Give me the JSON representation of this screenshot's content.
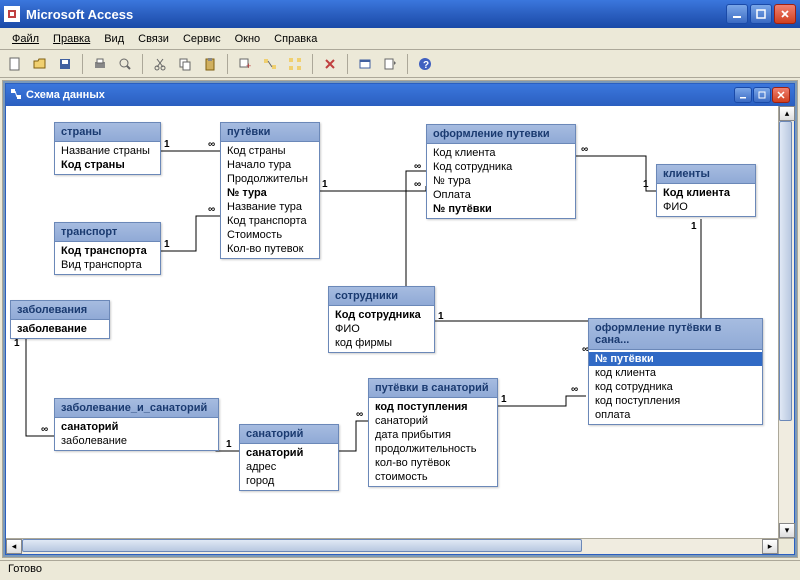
{
  "app": {
    "title": "Microsoft Access",
    "status": "Готово"
  },
  "menu": {
    "file": "Файл",
    "edit": "Правка",
    "view": "Вид",
    "relations": "Связи",
    "service": "Сервис",
    "window": "Окно",
    "help": "Справка"
  },
  "inner": {
    "title": "Схема данных"
  },
  "tables": {
    "countries": {
      "title": "страны",
      "f0": "Название страны",
      "f1": "Код страны"
    },
    "tours": {
      "title": "путёвки",
      "f0": "Код страны",
      "f1": "Начало тура",
      "f2": "Продолжительн",
      "f3": "№ тура",
      "f4": "Название тура",
      "f5": "Код транспорта",
      "f6": "Стоимость",
      "f7": "Кол-во путевок"
    },
    "transport": {
      "title": "транспорт",
      "f0": "Код транспорта",
      "f1": "Вид транспорта"
    },
    "diseases": {
      "title": "заболевания",
      "f0": "заболевание"
    },
    "disease_resort": {
      "title": "заболевание_и_санаторий",
      "f0": "санаторий",
      "f1": "заболевание"
    },
    "resort": {
      "title": "санаторий",
      "f0": "санаторий",
      "f1": "адрес",
      "f2": "город"
    },
    "employees": {
      "title": "сотрудники",
      "f0": "Код сотрудника",
      "f1": "ФИО",
      "f2": "код фирмы"
    },
    "tour_booking": {
      "title": "оформление путевки",
      "f0": "Код клиента",
      "f1": "Код сотрудника",
      "f2": "№ тура",
      "f3": "Оплата",
      "f4": "№ путёвки"
    },
    "clients": {
      "title": "клиенты",
      "f0": "Код клиента",
      "f1": "ФИО"
    },
    "resort_tours": {
      "title": "путёвки в санаторий",
      "f0": "код поступления",
      "f1": "санаторий",
      "f2": "дата прибытия",
      "f3": "продолжительность",
      "f4": "кол-во путёвок",
      "f5": "стоимость"
    },
    "resort_booking": {
      "title": "оформление путёвки в сана...",
      "f0": "№ путёвки",
      "f1": "код клиента",
      "f2": "код сотрудника",
      "f3": "код поступления",
      "f4": "оплата"
    }
  },
  "rel": {
    "one": "1",
    "inf": "∞"
  }
}
